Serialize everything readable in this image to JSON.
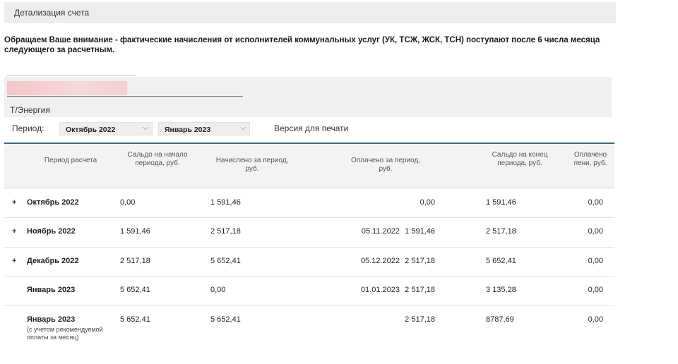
{
  "page": {
    "title": "Детализация счета",
    "notice": "Обращаем Ваше внимание - фактические начисления от исполнителей коммунальных услуг (УК, ТСЖ, ЖСК, ТСН) поступают после 6 числа месяца следующего за расчетным.",
    "provider": "Т/Энергия"
  },
  "filters": {
    "period_label": "Период:",
    "from": "Октябрь 2022",
    "to": "Январь 2023",
    "print_link": "Версия для печати"
  },
  "table": {
    "headers": [
      "Период расчета",
      "Сальдо на начало периода, руб.",
      "Начислено за период, руб.",
      "Оплачено за период, руб.",
      "Сальдо на конец периода, руб.",
      "Оплачено пени, руб."
    ],
    "rows": [
      {
        "expand": "+",
        "period": "Октябрь 2022",
        "start": "0,00",
        "charged": "1 591,46",
        "paid_date": "",
        "paid": "0,00",
        "end": "1 591,46",
        "penalty": "0,00"
      },
      {
        "expand": "+",
        "period": "Ноябрь 2022",
        "start": "1 591,46",
        "charged": "2 517,18",
        "paid_date": "05.11.2022",
        "paid": "1 591,46",
        "end": "2 517,18",
        "penalty": "0,00"
      },
      {
        "expand": "+",
        "period": "Декабрь 2022",
        "start": "2 517,18",
        "charged": "5 652,41",
        "paid_date": "05.12.2022",
        "paid": "2 517,18",
        "end": "5 652,41",
        "penalty": "0,00"
      },
      {
        "expand": "",
        "period": "Январь 2023",
        "start": "5 652,41",
        "charged": "0,00",
        "paid_date": "01.01.2023",
        "paid": "2 517,18",
        "end": "3 135,28",
        "penalty": "0,00"
      },
      {
        "expand": "",
        "period": "Январь 2023",
        "note": "(с учетом рекомендуемой оплаты за месяц)",
        "start": "5 652,41",
        "charged": "5 652,41",
        "paid_date": "",
        "paid": "2 517,18",
        "end": "8787,69",
        "penalty": "0,00"
      }
    ]
  }
}
